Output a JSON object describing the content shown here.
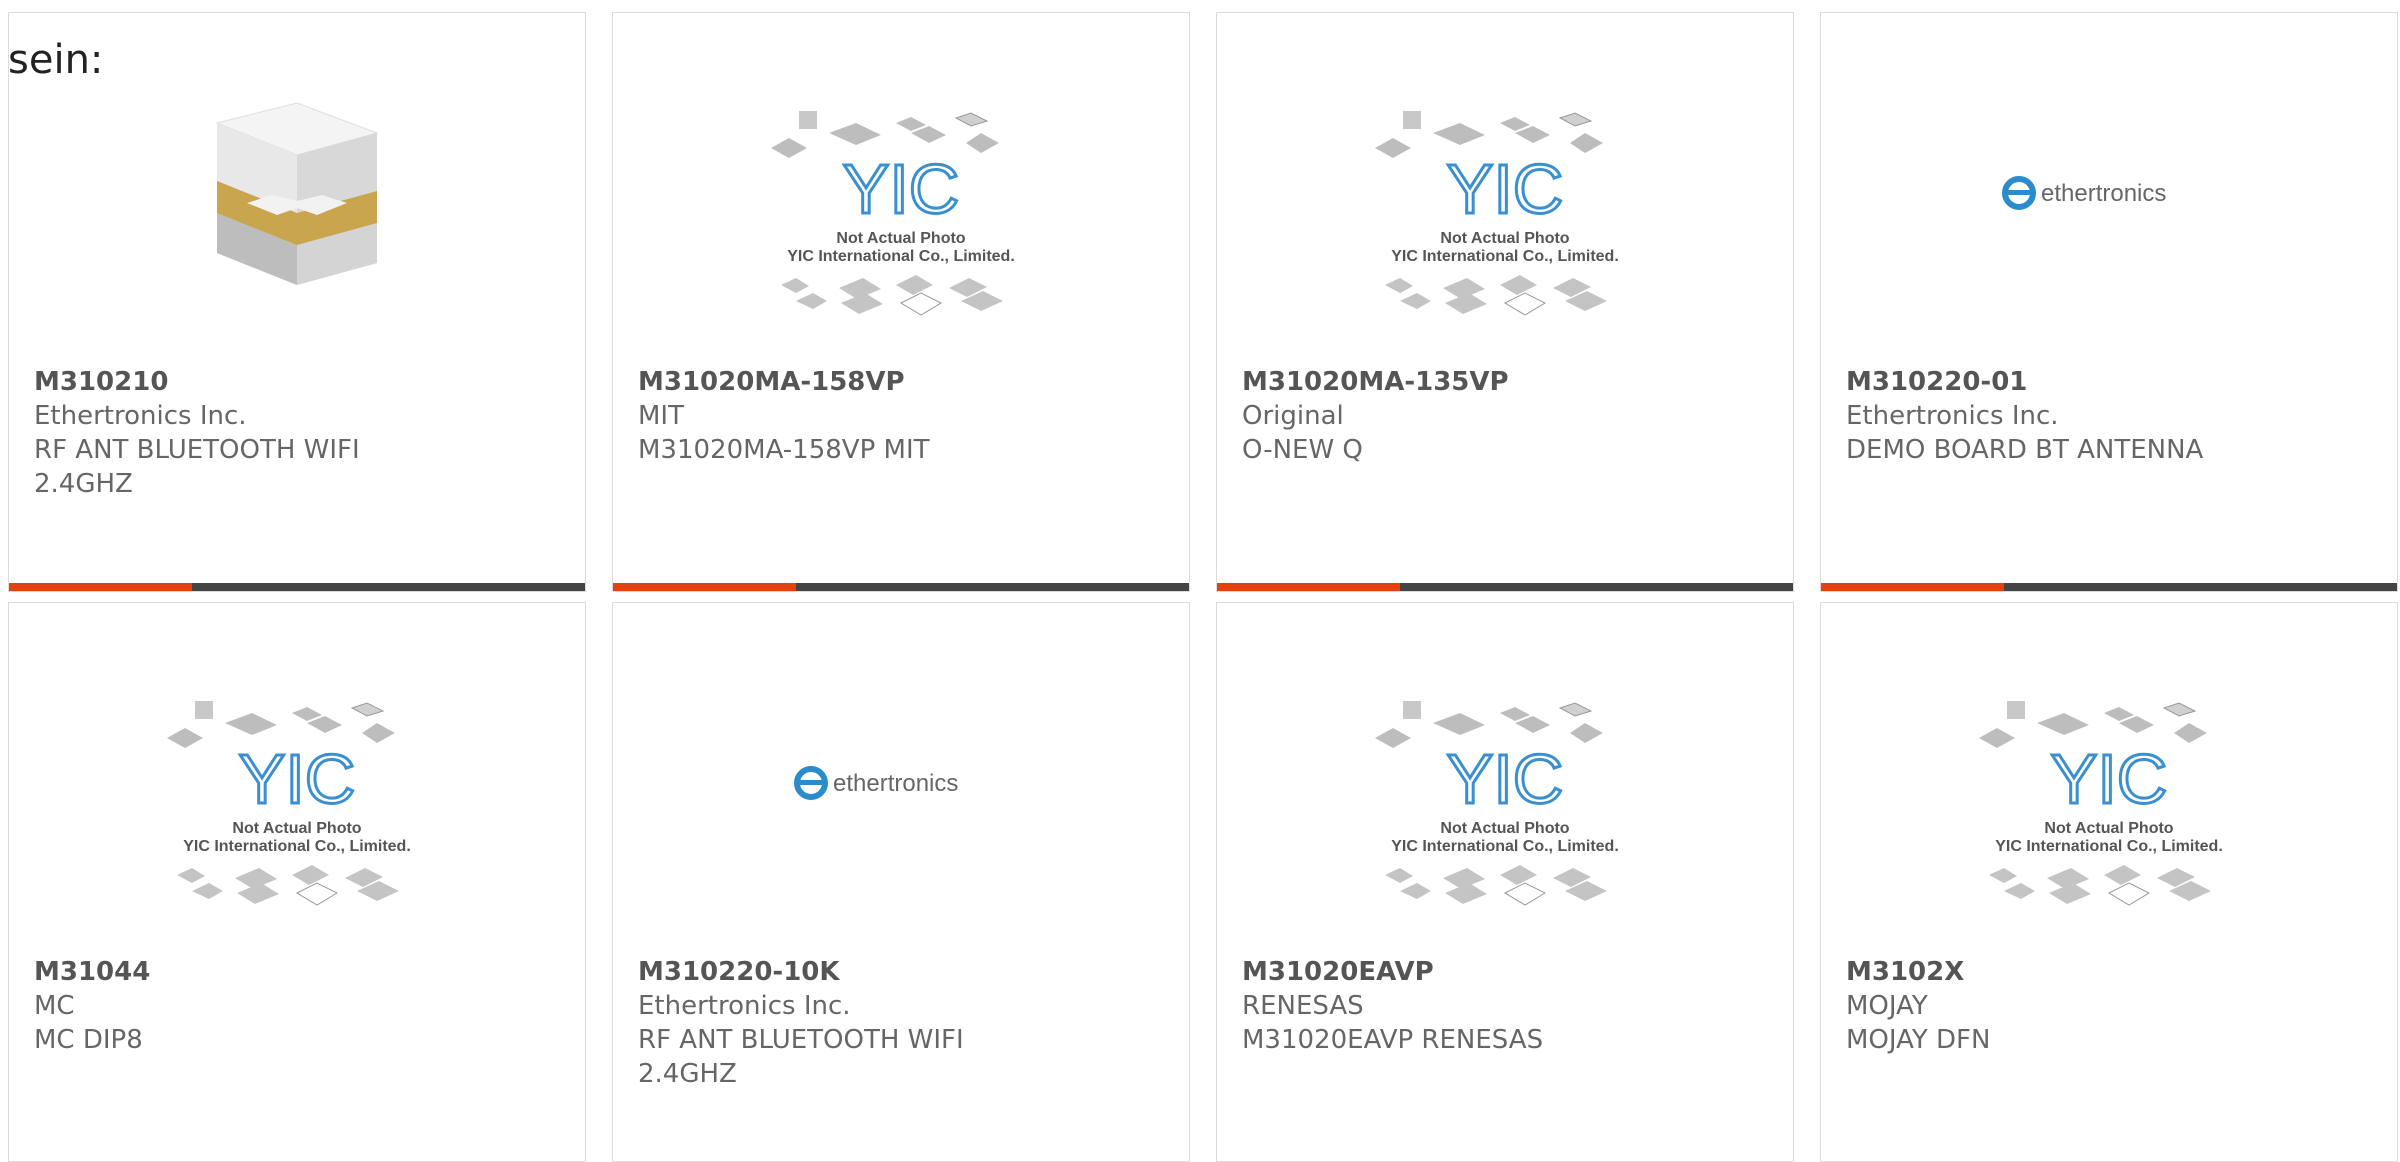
{
  "lead_text": "sein:",
  "colors": {
    "accent": "#e8400c",
    "bar": "#444444"
  },
  "products": [
    {
      "part": "M310210",
      "line1": "Ethertronics Inc.",
      "line2": "RF ANT BLUETOOTH WIFI",
      "line3": "2.4GHZ",
      "image": "chip-antenna-photo"
    },
    {
      "part": "M31020MA-158VP",
      "line1": "MIT",
      "line2": "M31020MA-158VP MIT",
      "line3": "",
      "image": "yic-placeholder"
    },
    {
      "part": "M31020MA-135VP",
      "line1": "Original",
      "line2": "O-NEW Q",
      "line3": "",
      "image": "yic-placeholder"
    },
    {
      "part": "M310220-01",
      "line1": "Ethertronics Inc.",
      "line2": "DEMO BOARD BT ANTENNA",
      "line3": "",
      "image": "ethertronics-logo"
    },
    {
      "part": "M31044",
      "line1": "MC",
      "line2": "MC DIP8",
      "line3": "",
      "image": "yic-placeholder"
    },
    {
      "part": "M310220-10K",
      "line1": "Ethertronics Inc.",
      "line2": "RF ANT BLUETOOTH WIFI",
      "line3": "2.4GHZ",
      "image": "ethertronics-logo"
    },
    {
      "part": "M31020EAVP",
      "line1": "RENESAS",
      "line2": "M31020EAVP RENESAS",
      "line3": "",
      "image": "yic-placeholder"
    },
    {
      "part": "M3102X",
      "line1": "MOJAY",
      "line2": "MOJAY DFN",
      "line3": "",
      "image": "yic-placeholder"
    }
  ],
  "yic": {
    "logo": "YIC",
    "caption1": "Not Actual Photo",
    "caption2": "YIC International Co., Limited."
  },
  "ethertronics": {
    "logo_text": "ethertronics"
  }
}
